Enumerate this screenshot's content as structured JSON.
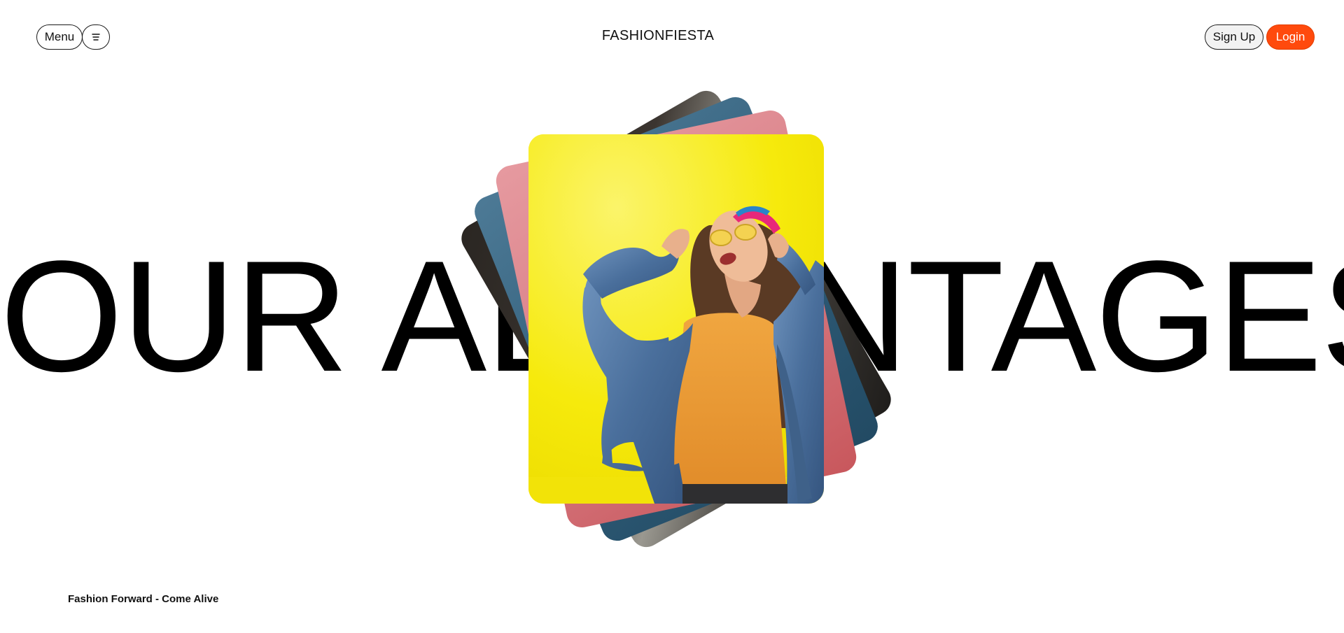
{
  "header": {
    "menu_label": "Menu",
    "menu_icon": "hamburger-icon",
    "brand": "FASHIONFIESTA",
    "signup_label": "Sign Up",
    "login_label": "Login"
  },
  "hero": {
    "headline": "OUR ADVANTAGES",
    "tagline": "Fashion Forward - Come Alive"
  },
  "cards": [
    {
      "name": "dark-card",
      "color": "#2e2a26"
    },
    {
      "name": "blue-card",
      "color": "#2f5c78"
    },
    {
      "name": "pink-card",
      "color": "#d87d85"
    },
    {
      "name": "photo-card",
      "color": "#f7ec12"
    }
  ],
  "colors": {
    "accent": "#ff4a0d",
    "background": "#ffffff",
    "text": "#000000"
  }
}
